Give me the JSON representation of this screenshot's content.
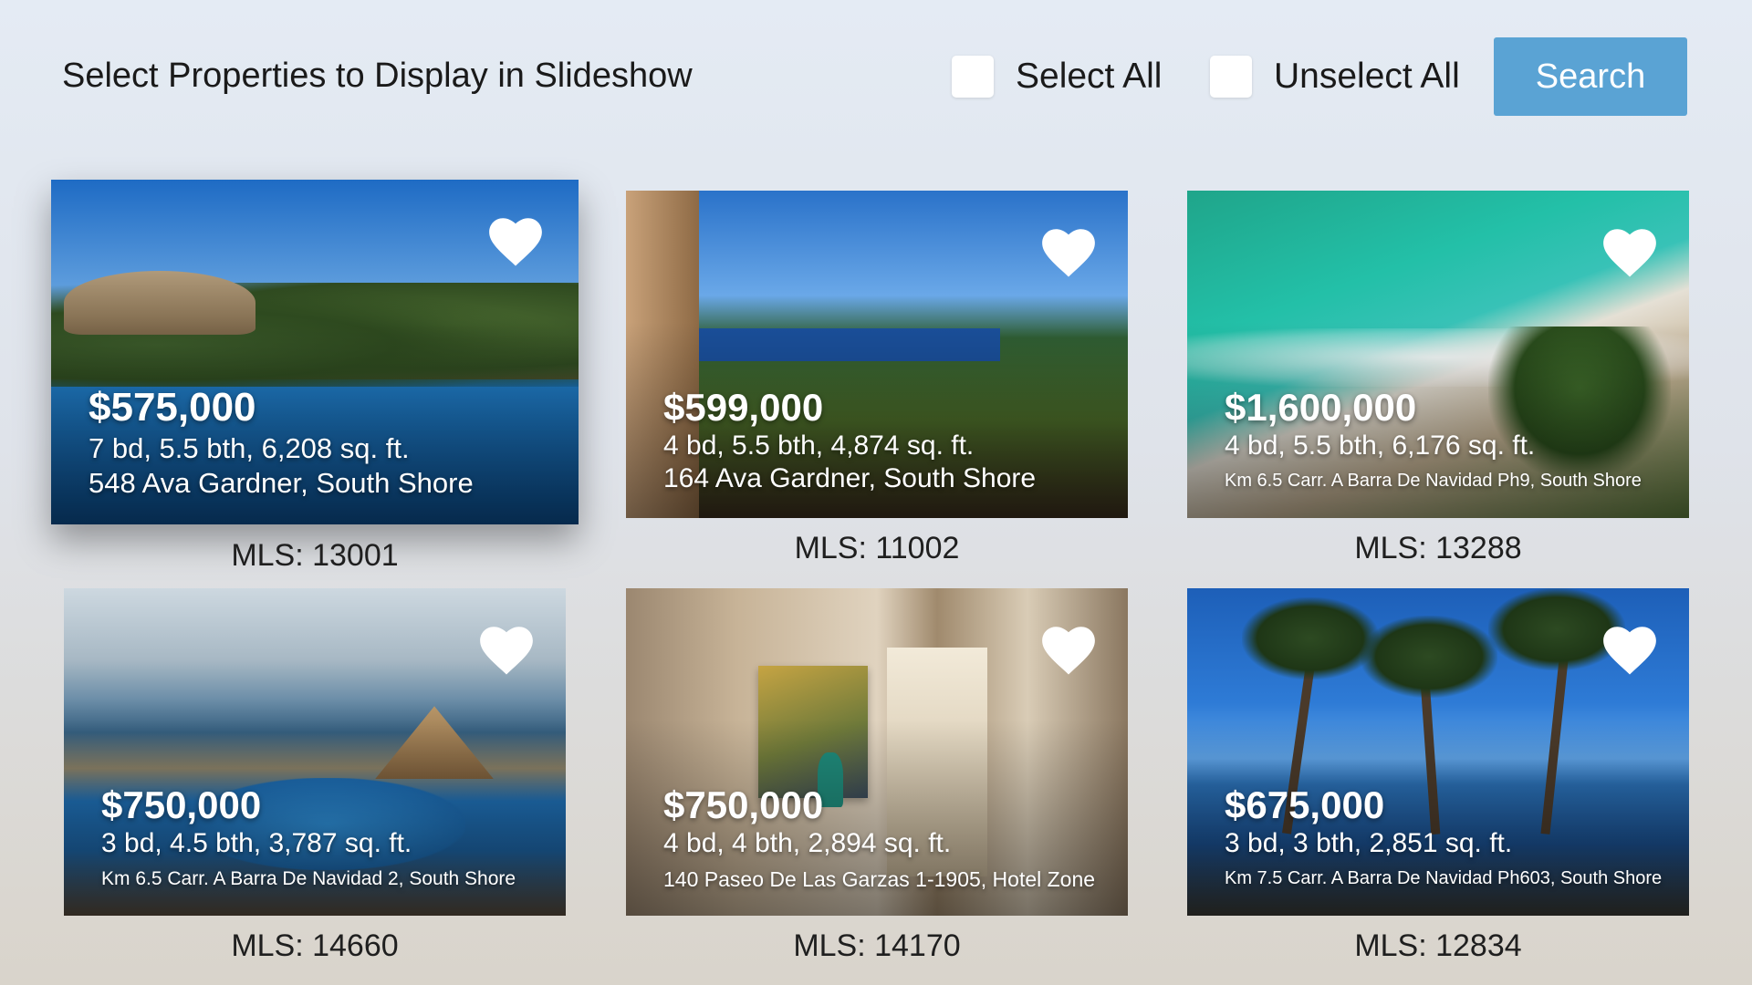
{
  "header": {
    "title": "Select Properties to Display in Slideshow",
    "select_all_label": "Select All",
    "unselect_all_label": "Unselect All",
    "search_label": "Search"
  },
  "properties": [
    {
      "price": "$575,000",
      "specs": "7 bd, 5.5 bth, 6,208 sq. ft.",
      "address": "548 Ava Gardner, South Shore",
      "mls": "MLS: 13001",
      "focused": true
    },
    {
      "price": "$599,000",
      "specs": "4 bd, 5.5 bth, 4,874 sq. ft.",
      "address": "164 Ava Gardner, South Shore",
      "mls": "MLS: 11002"
    },
    {
      "price": "$1,600,000",
      "specs": "4 bd, 5.5 bth, 6,176 sq. ft.",
      "address": "Km 6.5 Carr. A Barra De Navidad Ph9, South Shore",
      "mls": "MLS: 13288"
    },
    {
      "price": "$750,000",
      "specs": "3 bd, 4.5 bth, 3,787 sq. ft.",
      "address": "Km 6.5 Carr. A Barra De Navidad 2, South Shore",
      "mls": "MLS: 14660"
    },
    {
      "price": "$750,000",
      "specs": "4 bd, 4 bth, 2,894 sq. ft.",
      "address": "140 Paseo De Las Garzas 1-1905, Hotel Zone",
      "mls": "MLS: 14170"
    },
    {
      "price": "$675,000",
      "specs": "3 bd, 3 bth, 2,851 sq. ft.",
      "address": "Km 7.5 Carr. A Barra De Navidad Ph603, South Shore",
      "mls": "MLS: 12834"
    }
  ],
  "icons": {
    "favorite": "heart-icon",
    "checkbox": "checkbox-icon"
  },
  "colors": {
    "accent": "#5aa3d4"
  }
}
